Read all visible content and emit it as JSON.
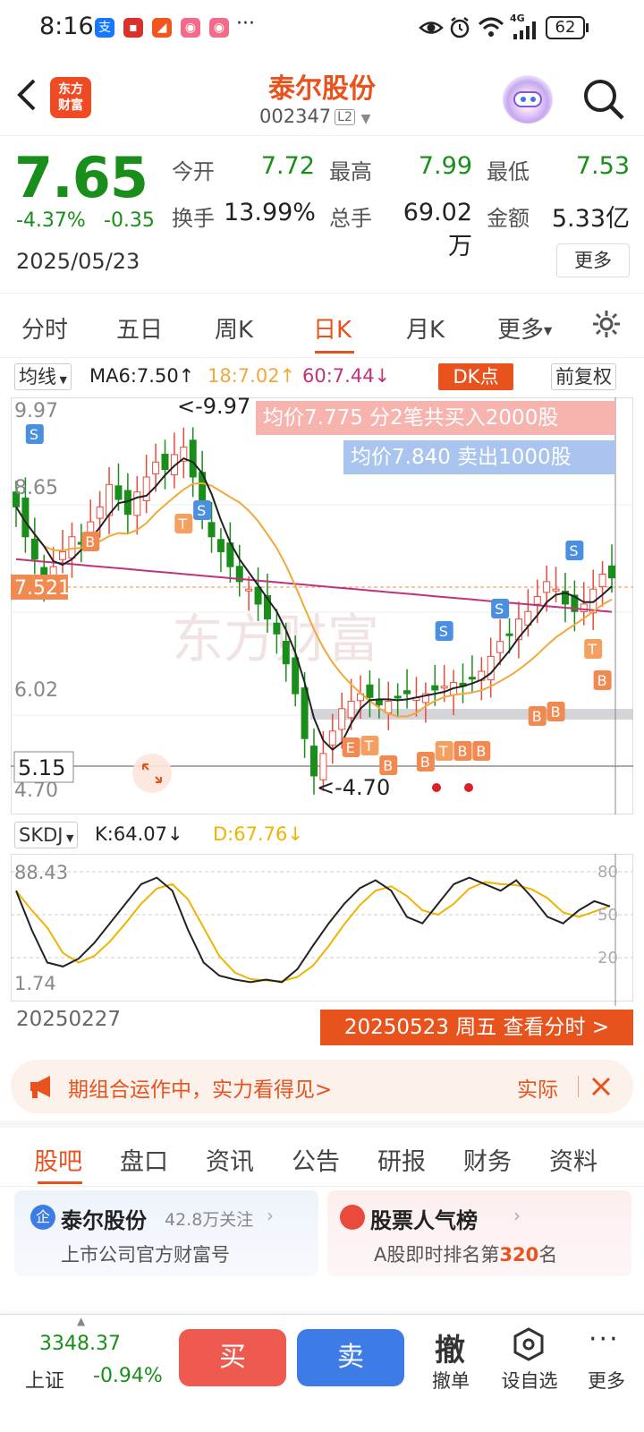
{
  "status_bar": {
    "time": "8:16",
    "battery": "62",
    "network": "4G"
  },
  "header": {
    "logo_text": "东方\n财富",
    "stock_name": "泰尔股份",
    "stock_code": "002347",
    "level": "L2"
  },
  "quote": {
    "price": "7.65",
    "change_pct": "-4.37%",
    "change_amt": "-0.35",
    "date": "2025/05/23",
    "open_label": "今开",
    "open": "7.72",
    "high_label": "最高",
    "high": "7.99",
    "low_label": "最低",
    "low": "7.53",
    "turnover_label": "换手",
    "turnover": "13.99%",
    "volume_label": "总手",
    "volume": "69.02万",
    "amount_label": "金额",
    "amount": "5.33亿",
    "more_label": "更多"
  },
  "tabs": [
    "分时",
    "五日",
    "周K",
    "日K",
    "月K",
    "更多"
  ],
  "active_tab": "日K",
  "indicator_bar": {
    "type": "均线",
    "ma6": "MA6:7.50↑",
    "ma18": "18:7.02↑",
    "ma60": "60:7.44↓",
    "dk": "DK点",
    "adjust": "前复权"
  },
  "kline": {
    "axis_top": "9.97",
    "axis_2": "8.65",
    "axis_3": "6.02",
    "axis_bottom": "4.70",
    "max_label": "<-9.97",
    "min_label": "<-4.70",
    "current_price_tag": "7.521",
    "crosshair_price": "5.15",
    "buy_note": "均价7.775  分2笔共买入2000股",
    "sell_note": "均价7.840  卖出1000股",
    "watermark": "东方财富"
  },
  "kd": {
    "name": "SKDJ",
    "k": "K:64.07↓",
    "d": "D:67.76↓",
    "axis_top": "88.43",
    "axis_bottom": "1.74",
    "levels": [
      "80",
      "50",
      "20"
    ]
  },
  "dates": {
    "start": "20250227",
    "current": "20250523 周五 查看分时 >"
  },
  "banner": {
    "text": "期组合运作中，实力看得见>",
    "right": "实际"
  },
  "subtabs": [
    "股吧",
    "盘口",
    "资讯",
    "公告",
    "研报",
    "财务",
    "资料"
  ],
  "cards": {
    "left_title": "泰尔股份",
    "left_follow": "42.8万关注",
    "left_sub": "上市公司官方财富号",
    "right_title": "股票人气榜",
    "right_sub_pre": "A股即时排名第",
    "right_rank": "320",
    "right_sub_post": "名"
  },
  "bottom": {
    "index_value": "3348.37",
    "index_name": "上证",
    "index_change": "-0.94%",
    "buy": "买",
    "sell": "卖",
    "cancel_icon": "撤",
    "cancel": "撤单",
    "watch": "设自选",
    "more": "更多"
  },
  "colors": {
    "up": "#e84a3c",
    "down": "#1a8e1a",
    "accent": "#e8531d",
    "ma6": "#222222",
    "ma18": "#f0a93a",
    "ma60": "#c0327a"
  }
}
